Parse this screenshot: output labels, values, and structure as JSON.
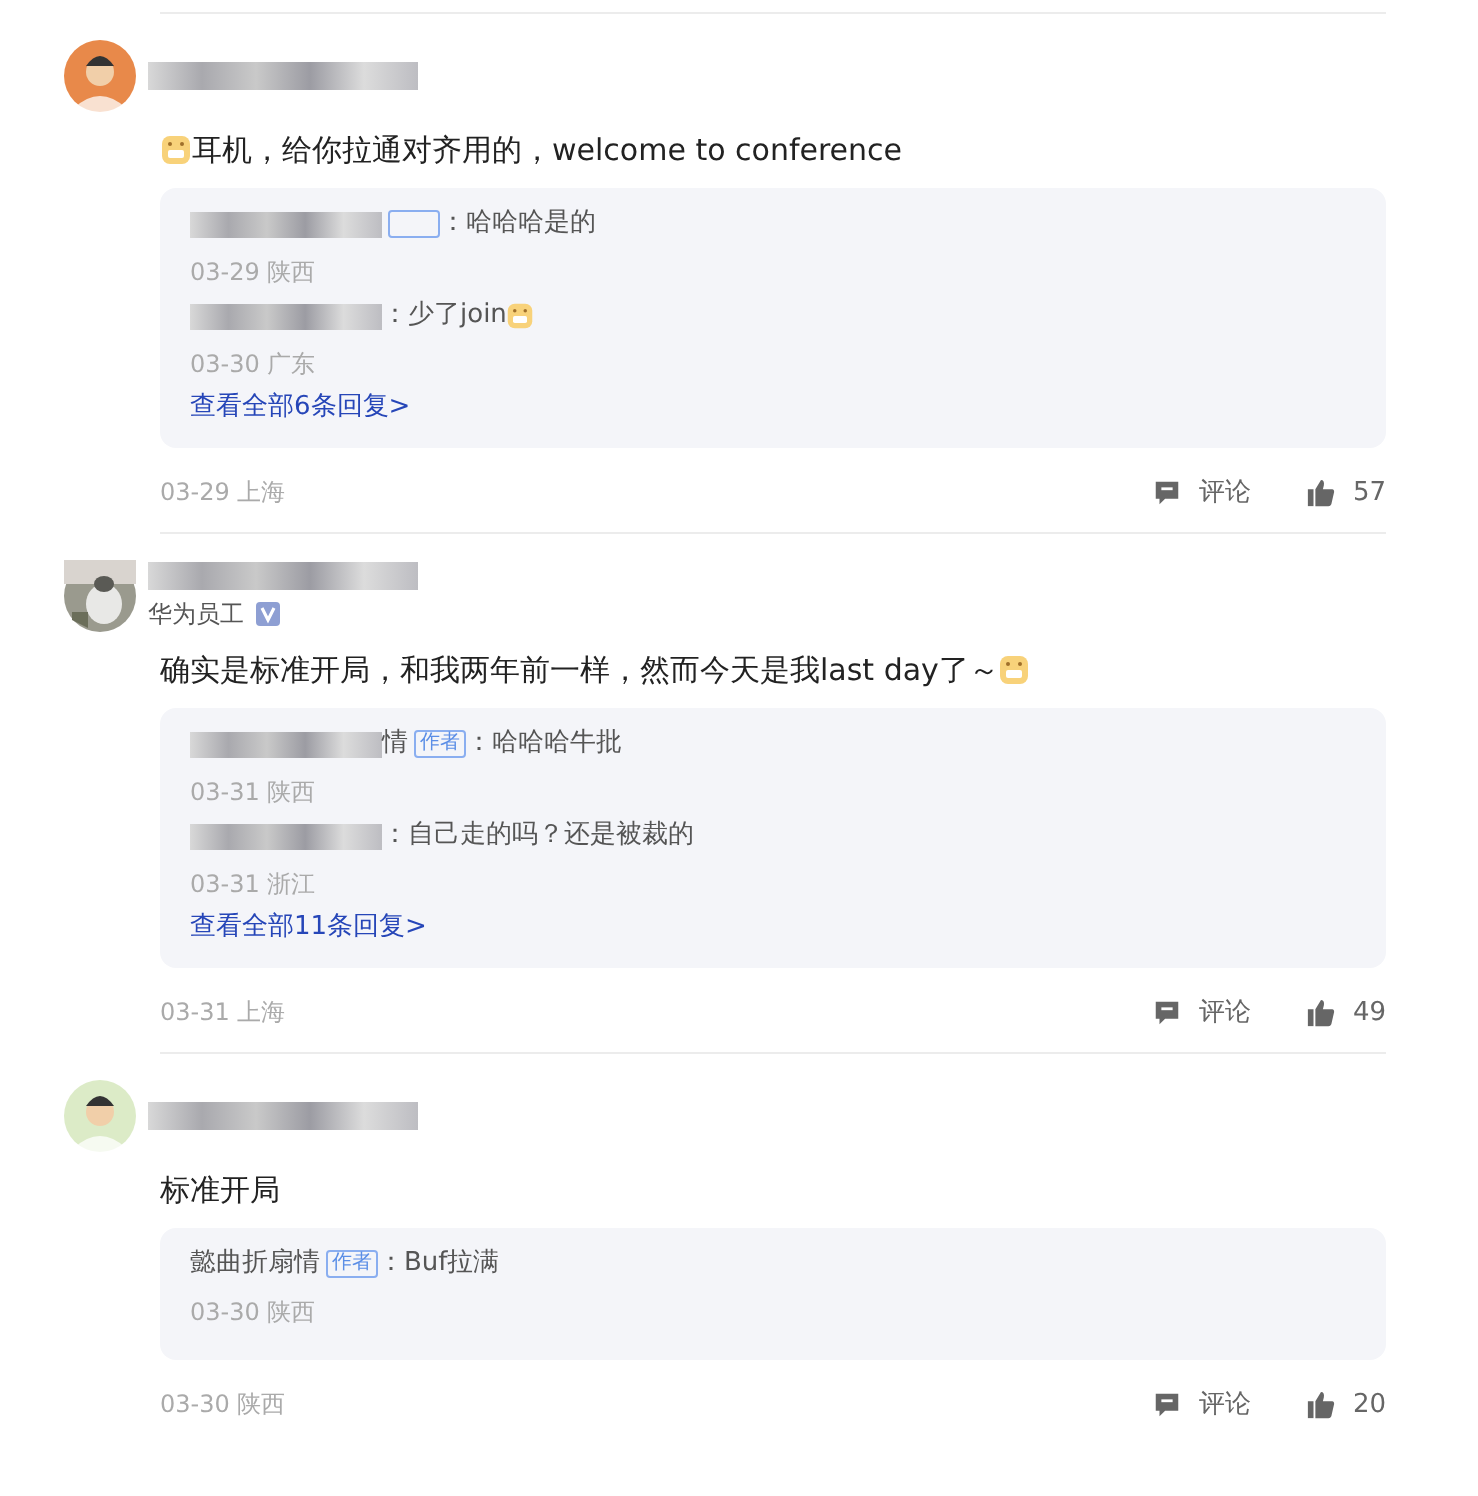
{
  "comments": [
    {
      "avatar": {
        "kind": "figure",
        "color": "#e8894a"
      },
      "redacted_name": true,
      "content": [
        {
          "kind": "emoji"
        },
        {
          "kind": "text",
          "text": "耳机，给你拉通对齐用的，welcome to conference"
        }
      ],
      "replies": [
        {
          "redacted_name": true,
          "badge_shown": true,
          "text": "：哈哈哈是的",
          "meta": "03-29 陕西"
        },
        {
          "redacted_name": true,
          "text": "：少了join",
          "content_emoji": true,
          "meta": "03-30 广东"
        }
      ],
      "more": "查看全部6条回复>",
      "meta": "03-29 上海",
      "comment_label": "评论",
      "likes": "57"
    },
    {
      "avatar": {
        "kind": "picture"
      },
      "redacted_name": true,
      "subtitle": "华为员工",
      "verified": true,
      "content": [
        {
          "kind": "text",
          "text": "确实是标准开局，和我两年前一样，然而今天是我last day了～"
        },
        {
          "kind": "emoji"
        }
      ],
      "replies": [
        {
          "redacted_name": true,
          "name": "情",
          "badge_shown": true,
          "badge": "作者",
          "text": "：哈哈哈牛批",
          "meta": "03-31 陕西"
        },
        {
          "redacted_name": true,
          "text": "：自己走的吗？还是被裁的",
          "meta": "03-31 浙江"
        }
      ],
      "more": "查看全部11条回复>",
      "meta": "03-31 上海",
      "comment_label": "评论",
      "likes": "49"
    },
    {
      "avatar": {
        "kind": "figure",
        "color": "#dcebc7"
      },
      "redacted_name": true,
      "content": [
        {
          "kind": "text",
          "text": "标准开局"
        }
      ],
      "replies": [
        {
          "name": "懿曲折扇情",
          "badge_shown": true,
          "badge": "作者",
          "text": "：Buf拉满",
          "meta": "03-30 陕西"
        }
      ],
      "meta": "03-30 陕西",
      "comment_label": "评论",
      "likes": "20"
    }
  ]
}
